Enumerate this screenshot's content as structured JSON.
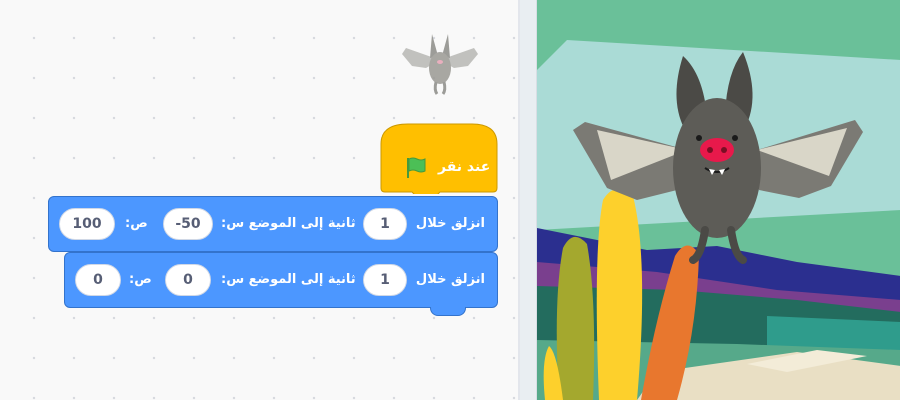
{
  "script": {
    "hat_block": {
      "label": "عند نقر",
      "icon": "green-flag-icon"
    },
    "glide_blocks": [
      {
        "prefix": "انزلق خلال",
        "secs": "1",
        "middle": "ثانية إلى الموضع س:",
        "x": "-50",
        "y_label": "ص:",
        "y": "100"
      },
      {
        "prefix": "انزلق خلال",
        "secs": "1",
        "middle": "ثانية إلى الموضع س:",
        "x": "0",
        "y_label": "ص:",
        "y": "0"
      }
    ]
  },
  "sprite": {
    "icon": "bat-sprite-icon"
  },
  "colors": {
    "events": "#ffbf00",
    "motion": "#4c97ff",
    "flag": "#4cbf56",
    "stage_sky": "#6ac099",
    "bat_body": "#5d5c57",
    "bat_nose": "#e8194b"
  }
}
